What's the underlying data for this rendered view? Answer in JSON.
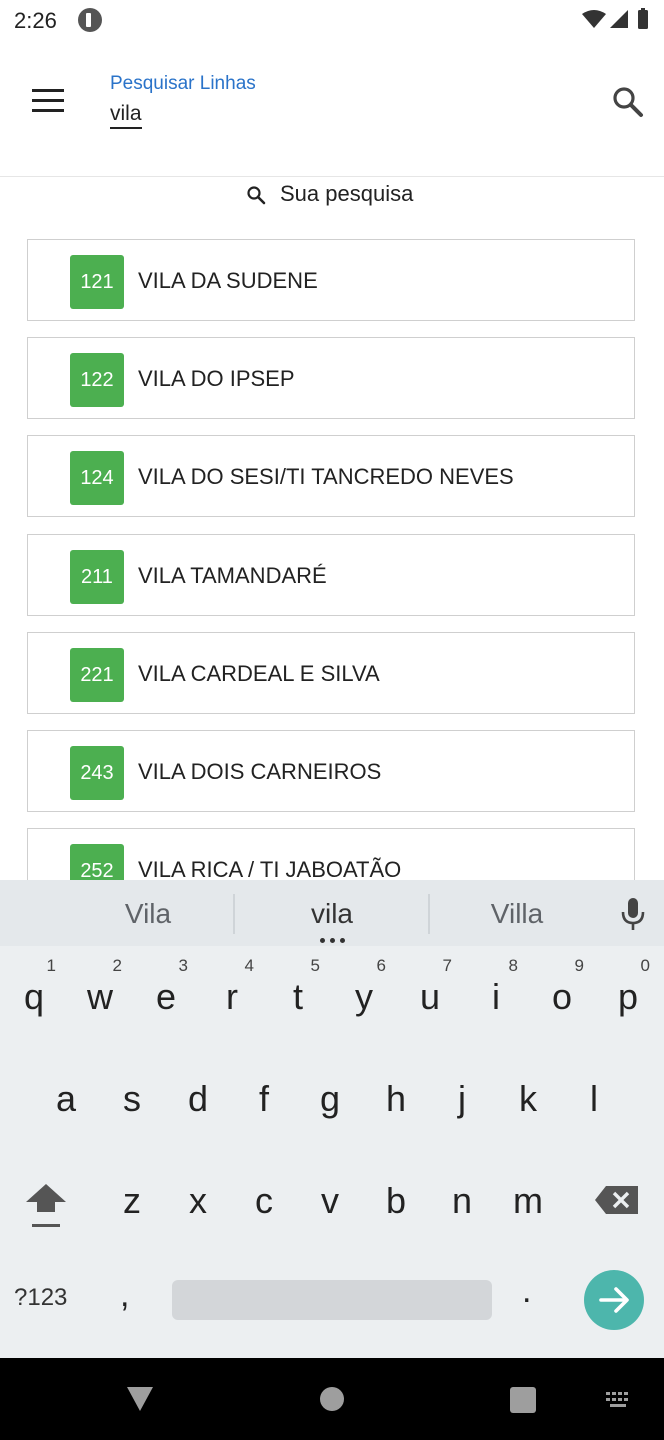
{
  "status_bar": {
    "time": "2:26"
  },
  "header": {
    "search_label": "Pesquisar Linhas",
    "search_value": "vila"
  },
  "results": {
    "header": "Sua pesquisa",
    "items": [
      {
        "number": "121",
        "name": "VILA DA SUDENE"
      },
      {
        "number": "122",
        "name": "VILA DO IPSEP"
      },
      {
        "number": "124",
        "name": "VILA DO SESI/TI TANCREDO NEVES"
      },
      {
        "number": "211",
        "name": "VILA TAMANDARÉ"
      },
      {
        "number": "221",
        "name": "VILA CARDEAL E SILVA"
      },
      {
        "number": "243",
        "name": "VILA DOIS CARNEIROS"
      },
      {
        "number": "252",
        "name": "VILA RICA / TI JABOATÃO"
      }
    ],
    "badge_color": "#4caf50"
  },
  "keyboard": {
    "suggestions": [
      "Vila",
      "vila",
      "Villa"
    ],
    "row1": [
      "q",
      "w",
      "e",
      "r",
      "t",
      "y",
      "u",
      "i",
      "o",
      "p"
    ],
    "row1_hints": [
      "1",
      "2",
      "3",
      "4",
      "5",
      "6",
      "7",
      "8",
      "9",
      "0"
    ],
    "row2": [
      "a",
      "s",
      "d",
      "f",
      "g",
      "h",
      "j",
      "k",
      "l"
    ],
    "row3": [
      "z",
      "x",
      "c",
      "v",
      "b",
      "n",
      "m"
    ],
    "symbols_label": "?123",
    "comma": ",",
    "period": ".",
    "enter_color": "#4db6ac"
  },
  "icons": {
    "menu": "menu-icon",
    "search": "search-icon",
    "mic": "mic-icon",
    "shift": "shift-icon",
    "backspace": "backspace-icon",
    "enter": "arrow-right-icon",
    "nav_back": "back-triangle-icon",
    "nav_home": "home-circle-icon",
    "nav_recents": "recents-square-icon",
    "nav_keyboard": "keyboard-icon"
  }
}
